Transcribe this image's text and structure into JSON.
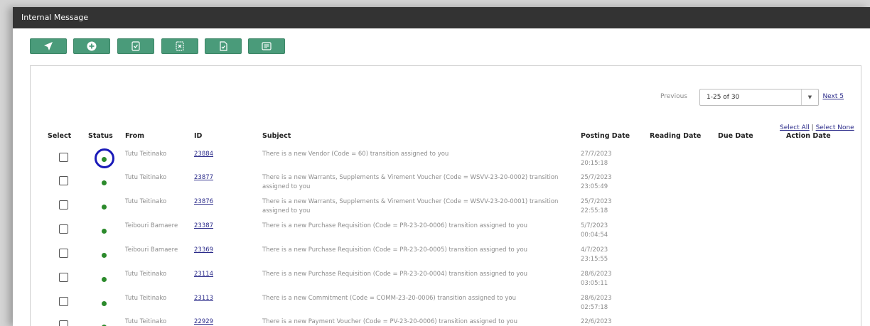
{
  "window": {
    "title": "Internal Message"
  },
  "toolbar": {
    "buttons": [
      {
        "icon": "send-icon"
      },
      {
        "icon": "add-circle-icon"
      },
      {
        "icon": "doc-check-icon"
      },
      {
        "icon": "doc-x-icon"
      },
      {
        "icon": "doc-approve-icon"
      },
      {
        "icon": "message-list-icon"
      }
    ]
  },
  "pager": {
    "previous": "Previous",
    "range": "1-25 of 30",
    "next": "Next 5"
  },
  "selection": {
    "select_all": "Select All",
    "separator": "|",
    "select_none": "Select None"
  },
  "table": {
    "headers": {
      "select": "Select",
      "status": "Status",
      "from": "From",
      "id": "ID",
      "subject": "Subject",
      "posting_date": "Posting Date",
      "reading_date": "Reading Date",
      "due_date": "Due Date",
      "action_date": "Action Date"
    },
    "rows": [
      {
        "from": "Tutu Teitinako",
        "id": "23884",
        "subject": "There is a new Vendor (Code = 60) transition assigned to you",
        "date": "27/7/2023",
        "time": "20:15:18",
        "status": "unread",
        "highlighted": true
      },
      {
        "from": "Tutu Teitinako",
        "id": "23877",
        "subject": "There is a new Warrants, Supplements & Virement Voucher (Code = WSVV-23-20-0002) transition assigned to you",
        "date": "25/7/2023",
        "time": "23:05:49",
        "status": "unread"
      },
      {
        "from": "Tutu Teitinako",
        "id": "23876",
        "subject": "There is a new Warrants, Supplements & Virement Voucher (Code = WSVV-23-20-0001) transition assigned to you",
        "date": "25/7/2023",
        "time": "22:55:18",
        "status": "unread"
      },
      {
        "from": "Teibouri Bamaere",
        "id": "23387",
        "subject": "There is a new Purchase Requisition (Code = PR-23-20-0006) transition assigned to you",
        "date": "5/7/2023",
        "time": "00:04:54",
        "status": "unread"
      },
      {
        "from": "Teibouri Bamaere",
        "id": "23369",
        "subject": "There is a new Purchase Requisition (Code = PR-23-20-0005) transition assigned to you",
        "date": "4/7/2023",
        "time": "23:15:55",
        "status": "unread"
      },
      {
        "from": "Tutu Teitinako",
        "id": "23114",
        "subject": "There is a new Purchase Requisition (Code = PR-23-20-0004) transition assigned to you",
        "date": "28/6/2023",
        "time": "03:05:11",
        "status": "unread"
      },
      {
        "from": "Tutu Teitinako",
        "id": "23113",
        "subject": "There is a new Commitment (Code = COMM-23-20-0006) transition assigned to you",
        "date": "28/6/2023",
        "time": "02:57:18",
        "status": "unread"
      },
      {
        "from": "Tutu Teitinako",
        "id": "22929",
        "subject": "There is a new Payment Voucher (Code = PV-23-20-0006) transition assigned to you",
        "date": "22/6/2023",
        "time": "",
        "status": "unread"
      }
    ]
  },
  "colors": {
    "titlebar": "#333333",
    "toolbar_button": "#4a9b7a",
    "status_dot": "#2b8a2b",
    "link": "#2b2b8a",
    "highlight_ring": "#1a1ab8"
  }
}
